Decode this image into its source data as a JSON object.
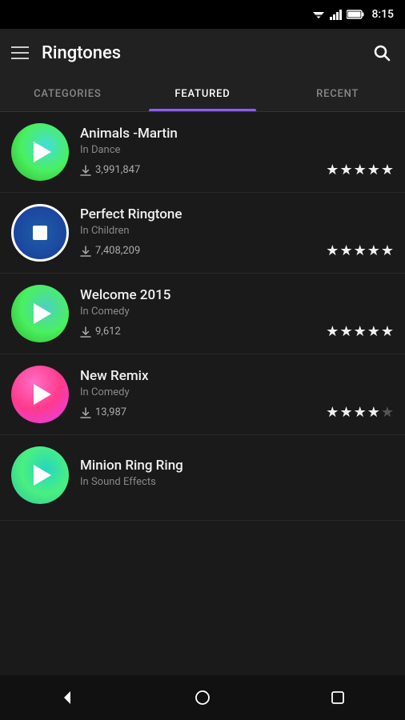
{
  "statusBar": {
    "time": "8:15"
  },
  "header": {
    "title": "Ringtones",
    "hamburgerIcon": "menu-icon",
    "searchIcon": "search-icon"
  },
  "tabs": [
    {
      "label": "CATEGORIES",
      "active": false
    },
    {
      "label": "FEATURED",
      "active": true
    },
    {
      "label": "RECENT",
      "active": false
    }
  ],
  "songs": [
    {
      "title": "Animals -Martin",
      "genre": "In Dance",
      "downloads": "3,991,847",
      "stars": 5,
      "gradientClass": "gradient-green",
      "isPlaying": false
    },
    {
      "title": "Perfect Ringtone",
      "genre": "In Children",
      "downloads": "7,408,209",
      "stars": 5,
      "gradientClass": "gradient-blue",
      "isPlaying": true
    },
    {
      "title": "Welcome 2015",
      "genre": "In Comedy",
      "downloads": "9,612",
      "stars": 5,
      "gradientClass": "gradient-teal",
      "isPlaying": false
    },
    {
      "title": "New Remix",
      "genre": "In Comedy",
      "downloads": "13,987",
      "stars": 4,
      "gradientClass": "gradient-pink",
      "isPlaying": false
    },
    {
      "title": "Minion Ring Ring",
      "genre": "In Sound Effects",
      "downloads": "",
      "stars": 0,
      "gradientClass": "gradient-teal2",
      "isPlaying": false
    }
  ]
}
